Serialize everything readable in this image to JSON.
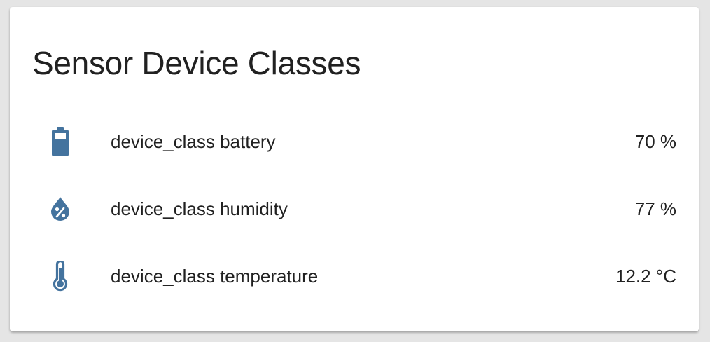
{
  "card": {
    "title": "Sensor Device Classes"
  },
  "colors": {
    "icon": "#44739e",
    "text": "#212121",
    "background": "#e5e5e5",
    "card": "#ffffff"
  },
  "entities": [
    {
      "icon": "battery-icon",
      "name": "device_class battery",
      "state": "70 %"
    },
    {
      "icon": "water-percent-icon",
      "name": "device_class humidity",
      "state": "77 %"
    },
    {
      "icon": "thermometer-icon",
      "name": "device_class temperature",
      "state": "12.2 °C"
    }
  ]
}
